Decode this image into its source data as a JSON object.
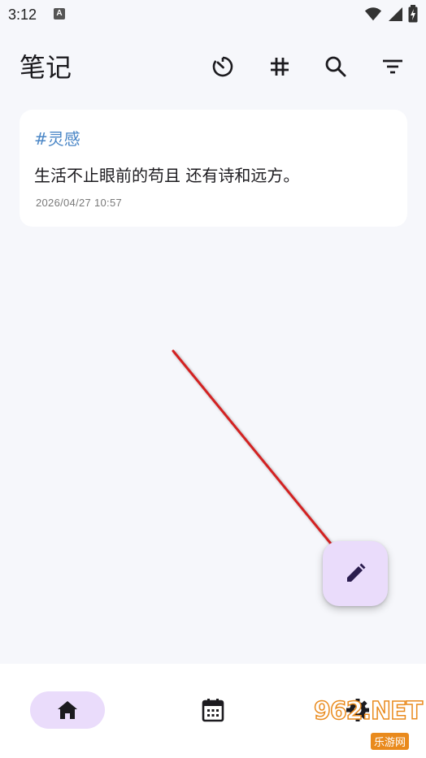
{
  "status_bar": {
    "time": "3:12",
    "indicator": "A"
  },
  "app_bar": {
    "title": "笔记",
    "actions": [
      {
        "name": "timer-icon"
      },
      {
        "name": "hashtag-icon"
      },
      {
        "name": "search-icon"
      },
      {
        "name": "filter-icon"
      }
    ]
  },
  "notes": [
    {
      "tag": "#灵感",
      "content": "生活不止眼前的苟且 还有诗和远方。",
      "date": "2026/04/27 10:57"
    }
  ],
  "fab": {
    "icon": "pencil-icon"
  },
  "bottom_nav": {
    "items": [
      {
        "icon": "home-icon",
        "active": true
      },
      {
        "icon": "calendar-icon",
        "active": false
      },
      {
        "icon": "gear-icon",
        "active": false
      }
    ]
  },
  "watermark": {
    "main": "962.NET",
    "sub": "乐游网"
  },
  "colors": {
    "background": "#f6f7fb",
    "accent": "#eadcfb",
    "tag": "#4a86c6",
    "icon_dark": "#2b1d4e",
    "arrow": "#d32020"
  }
}
